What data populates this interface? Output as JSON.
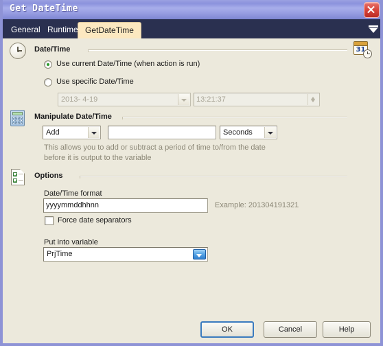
{
  "window": {
    "title": "Get DateTime",
    "close_icon": "close-icon"
  },
  "tabs": [
    {
      "label": "General",
      "active": false
    },
    {
      "label": "Runtime",
      "active": false
    },
    {
      "label": "GetDateTime",
      "active": true
    }
  ],
  "tab_overflow_icon": "chevron-down-icon",
  "groups": {
    "datetime": {
      "title": "Date/Time",
      "left_icon": "clock-icon",
      "right_icon": "calendar-clock-icon",
      "calendar_day": "31",
      "radios": [
        {
          "label": "Use current Date/Time (when action is run)",
          "checked": true
        },
        {
          "label": "Use specific Date/Time",
          "checked": false
        }
      ],
      "date_value": "2013- 4-19",
      "date_enabled": false,
      "time_value": "13:21:37",
      "time_enabled": false
    },
    "manipulate": {
      "title": "Manipulate Date/Time",
      "left_icon": "calculator-icon",
      "operation_value": "Add",
      "amount_value": "",
      "unit_value": "Seconds",
      "hint_line1": "This allows you to add or subtract a period of time to/from the date",
      "hint_line2": "before it is output to the variable"
    },
    "options": {
      "title": "Options",
      "left_icon": "checklist-document-icon",
      "format_label": "Date/Time format",
      "format_value": "yyyymmddhhnn",
      "example_text": "Example: 201304191321",
      "force_separators_label": "Force date separators",
      "force_separators_checked": false,
      "variable_label": "Put into variable",
      "variable_value": "PrjTime"
    }
  },
  "footer": {
    "ok_label": "OK",
    "cancel_label": "Cancel",
    "help_label": "Help"
  },
  "colors": {
    "titlebar": "#8b92dd",
    "tabstrip": "#2a3050",
    "active_tab": "#fce8c0",
    "client_bg": "#ece9dc",
    "window_border": "#8e93d6",
    "radio_dot": "#2e9b2e",
    "default_button_focus": "#3a7bbf",
    "close_button": "#d8453c"
  }
}
